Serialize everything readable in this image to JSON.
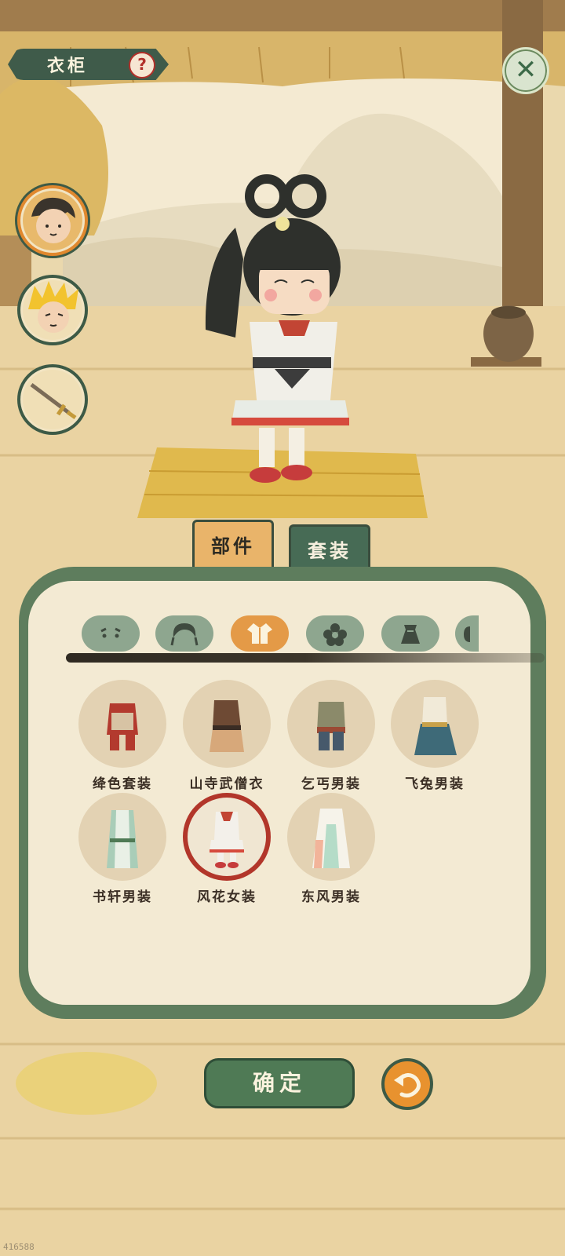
{
  "header": {
    "title": "衣柜",
    "help_glyph": "?",
    "close_glyph": "✕"
  },
  "characters": [
    {
      "name": "boy-hero",
      "active": true
    },
    {
      "name": "golden-hair-hero",
      "active": false
    },
    {
      "name": "sword",
      "active": false
    }
  ],
  "tabs": {
    "parts": "部件",
    "sets": "套装",
    "active": "parts"
  },
  "categories": [
    {
      "icon": "face-icon",
      "active": false
    },
    {
      "icon": "hair-icon",
      "active": false
    },
    {
      "icon": "clothes-icon",
      "active": true
    },
    {
      "icon": "flower-icon",
      "active": false
    },
    {
      "icon": "bag-icon",
      "active": false
    },
    {
      "icon": "more-icon",
      "active": false
    }
  ],
  "outfits": [
    {
      "label": "绛色套装",
      "selected": false
    },
    {
      "label": "山寺武僧衣",
      "selected": false
    },
    {
      "label": "乞丐男装",
      "selected": false
    },
    {
      "label": "飞兔男装",
      "selected": false
    },
    {
      "label": "书轩男装",
      "selected": false
    },
    {
      "label": "风花女装",
      "selected": true
    },
    {
      "label": "东风男装",
      "selected": false
    }
  ],
  "buttons": {
    "confirm": "确定"
  },
  "build_id": "416588",
  "colors": {
    "accent_green": "#4f7a55",
    "accent_orange": "#e8922f",
    "selected_ring": "#b2362a"
  }
}
